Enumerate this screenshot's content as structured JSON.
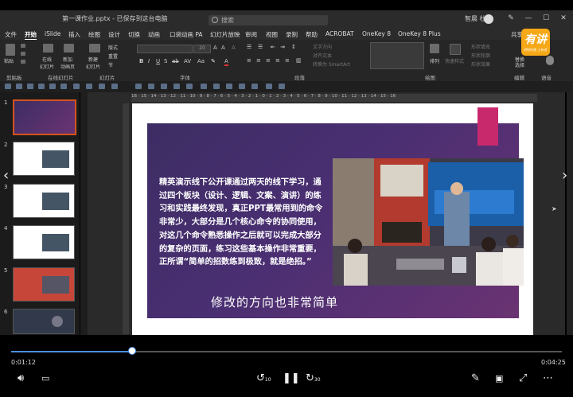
{
  "window": {
    "title": "第一课作业.pptx - 已保存到这台电脑",
    "search_placeholder": "搜索",
    "user_name": "智晨 杜",
    "controls": [
      "—",
      "☐",
      "✕"
    ]
  },
  "menu": {
    "tabs": [
      "文件",
      "开始",
      "iSlide",
      "插入",
      "绘图",
      "设计",
      "切换",
      "动画",
      "口袋动画 PA",
      "幻灯片放映",
      "审阅",
      "视图",
      "录制",
      "帮助",
      "ACROBAT",
      "OneKey 8",
      "OneKey 8 Plus"
    ],
    "active": "开始",
    "share": "共享"
  },
  "ribbon": {
    "paste": "粘贴",
    "online_slides": "在线\n幻灯片",
    "new_slide_anim": "新加\n动画页",
    "new_slide": "新建\n幻灯片",
    "layout": "版式",
    "reset": "重置",
    "section": "节",
    "text_direction": "文字方向",
    "align_text": "对齐文本",
    "smartart": "转换为 SmartArt",
    "arrange": "排列",
    "quick_styles": "快速样式",
    "shape_fill": "形状填充",
    "shape_outline": "形状轮廓",
    "shape_effects": "形状效果",
    "find": "查找",
    "replace": "替换",
    "select": "选择",
    "font_size": "20",
    "groups": {
      "clipboard": "剪贴板",
      "online_slides": "在线幻灯片",
      "slides": "幻灯片",
      "font": "字体",
      "paragraph": "段落",
      "drawing": "绘图",
      "editing": "编辑",
      "voice": "语音"
    }
  },
  "ruler_text": "16 · 15 · 14 · 13 · 12 · 11 · 10 · 9 · 8 · 7 · 6 · 5 · 4 · 3 · 2 · 1 · 0 · 1 · 2 · 3 · 4 · 5 · 6 · 7 · 8 · 9 · 10 · 11 · 12 · 13 · 14 · 15 · 16",
  "thumbnails": {
    "numbers": [
      "1",
      "2",
      "3",
      "4",
      "5",
      "6"
    ],
    "selected": 1
  },
  "slide": {
    "body": "精英演示线下公开课通过两天的线下学习，通过四个板块（设计、逻辑、文案、演讲）的练习和实践最终发现，真正PPT最常用到的命令非常少，大部分是几个核心命令的协同使用，对这几个命令熟悉操作之后就可以完成大部分的复杂的页面，练习这些基本操作非常重要，正所谓“简单的招数练到极致，就是绝招。”",
    "caption": "修改的方向也非常简单"
  },
  "player": {
    "current_time": "0:01:12",
    "total_time": "0:04:25",
    "progress": 0.22,
    "rewind_seconds": "10",
    "forward_seconds": "30"
  },
  "watermark": {
    "brand": "有讲",
    "tagline": "讲你所想 上有讲"
  },
  "colors": {
    "accent": "#c8296d",
    "selected_thumb": "#d4541c",
    "progress": "#4a90e2",
    "slide_panel": "#4a2f72"
  }
}
